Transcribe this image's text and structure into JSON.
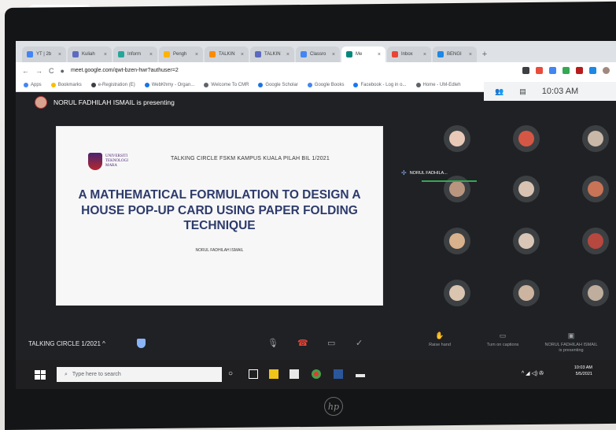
{
  "browser": {
    "tabs": [
      {
        "label": "YT | 2b",
        "color": "#4285f4"
      },
      {
        "label": "Kuliah",
        "color": "#5c6bc0"
      },
      {
        "label": "Inform",
        "color": "#26a69a"
      },
      {
        "label": "Pengh",
        "color": "#ffb300"
      },
      {
        "label": "TALKIN",
        "color": "#fb8c00"
      },
      {
        "label": "TALKIN",
        "color": "#5c6bc0"
      },
      {
        "label": "Classro",
        "color": "#4285f4"
      },
      {
        "label": "Me",
        "color": "#00897b",
        "active": true
      },
      {
        "label": "Inbox",
        "color": "#ea4335"
      },
      {
        "label": "BENGI",
        "color": "#1e88e5"
      }
    ],
    "new_tab": "+",
    "url": "meet.google.com/qwt-bzen-hwr?authuser=2",
    "bookmarks": [
      "Apps",
      "Bookmarks",
      "e-Registration (E)",
      "WebKhmy - Organ...",
      "Welcome To CMR",
      "Google Scholar",
      "Google Books",
      "Facebook - Log in o...",
      "Home - UM-Edleh"
    ]
  },
  "meet": {
    "presenting_banner": "NORUL FADHILAH ISMAIL is presenting",
    "time": "10:03 AM",
    "pinned_name": "NORUL FADHILA...",
    "slide": {
      "logo_lines": [
        "UNIVERSITI",
        "TEKNOLOGI",
        "MARA"
      ],
      "header": "TALKING CIRCLE FSKM KAMPUS KUALA PILAH BIL 1/2021",
      "title_lines": [
        "A MATHEMATICAL FORMULATION TO DESIGN A",
        "HOUSE POP-UP CARD USING PAPER FOLDING",
        "TECHNIQUE"
      ],
      "author": "NORUL FADHILAH ISMAIL"
    },
    "participant_colors": [
      "#e8c9b8",
      "#d45745",
      "#c9b7a8",
      "#b99580",
      "#d8c3b2",
      "#c97357",
      "#d8b28c",
      "#d9c6b6",
      "#b6483f",
      "#d9c5b0",
      "#cdb4a0",
      "#bfae9d"
    ],
    "controls": {
      "meeting_name": "TALKING CIRCLE 1/2021  ^",
      "raise_hand": "Raise hand",
      "captions": "Turn on captions",
      "presenting": [
        "NORUL FADHILAH ISMAIL",
        "is presenting"
      ]
    }
  },
  "taskbar": {
    "search_placeholder": "Type here to search",
    "tray_time": "10:03 AM",
    "tray_date": "5/5/2021"
  },
  "laptop": {
    "brand": "hp"
  }
}
